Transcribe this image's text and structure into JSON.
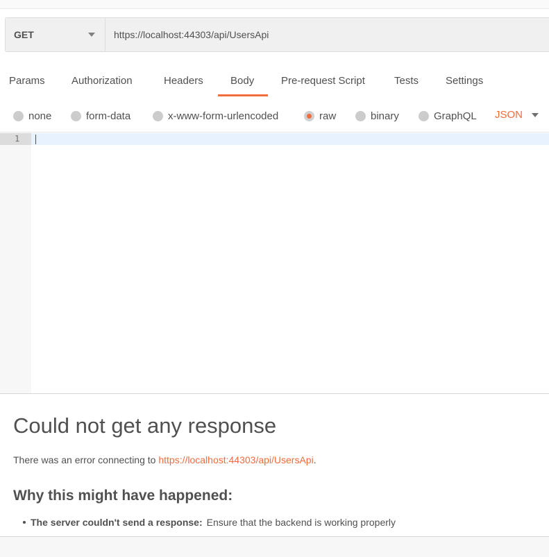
{
  "request": {
    "method": "GET",
    "url": "https://localhost:44303/api/UsersApi"
  },
  "tabs": [
    "Params",
    "Authorization",
    "Headers",
    "Body",
    "Pre-request Script",
    "Tests",
    "Settings"
  ],
  "active_tab": "Body",
  "body_options": {
    "items": [
      "none",
      "form-data",
      "x-www-form-urlencoded",
      "raw",
      "binary",
      "GraphQL"
    ],
    "selected": "raw",
    "format": "JSON"
  },
  "editor": {
    "line_number": "1",
    "content": ""
  },
  "response": {
    "title": "Could not get any response",
    "error_prefix": "There was an error connecting to ",
    "error_url": "https://localhost:44303/api/UsersApi",
    "error_suffix": ".",
    "why_heading": "Why this might have happened:",
    "reason_bold": "The server couldn't send a response:",
    "reason_text": "Ensure that the backend is working properly"
  },
  "colors": {
    "accent": "#f26b3a",
    "text": "#505050",
    "radio": "#cccccc"
  },
  "icons": {
    "method_dropdown": "chevron-down-icon",
    "format_dropdown": "chevron-down-icon"
  }
}
